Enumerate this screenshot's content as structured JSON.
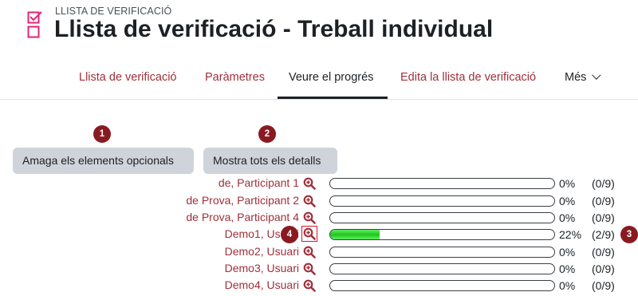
{
  "header": {
    "module_type": "LLISTA DE VERIFICACIÓ",
    "title": "Llista de verificació - Treball individual",
    "icon": "checklist-icon",
    "accent": "#e0267a"
  },
  "tabs": [
    {
      "label": "Llista de verificació",
      "active": false
    },
    {
      "label": "Paràmetres",
      "active": false
    },
    {
      "label": "Veure el progrés",
      "active": true
    },
    {
      "label": "Edita la llista de verificació",
      "active": false
    },
    {
      "label": "Més",
      "active": false
    }
  ],
  "buttons": {
    "hide_optional": "Amaga els elements opcionals",
    "show_details": "Mostra tots els detalls"
  },
  "markers": [
    "1",
    "2",
    "3",
    "4"
  ],
  "rows": [
    {
      "name": "de, Participant 1",
      "progress": 0,
      "pct": "0%",
      "count": "(0/9)"
    },
    {
      "name": "de Prova, Participant 2",
      "progress": 0,
      "pct": "0%",
      "count": "(0/9)"
    },
    {
      "name": "de Prova, Participant 4",
      "progress": 0,
      "pct": "0%",
      "count": "(0/9)"
    },
    {
      "name": "Demo1, Usuari",
      "progress": 22,
      "pct": "22%",
      "count": "(2/9)"
    },
    {
      "name": "Demo2, Usuari",
      "progress": 0,
      "pct": "0%",
      "count": "(0/9)"
    },
    {
      "name": "Demo3, Usuari",
      "progress": 0,
      "pct": "0%",
      "count": "(0/9)"
    },
    {
      "name": "Demo4, Usuari",
      "progress": 0,
      "pct": "0%",
      "count": "(0/9)"
    }
  ],
  "colors": {
    "link": "#a0303b",
    "marker": "#8a1a22",
    "progress": "#20c420",
    "button_bg": "#ced4da",
    "highlight_box": "#c8202a"
  }
}
